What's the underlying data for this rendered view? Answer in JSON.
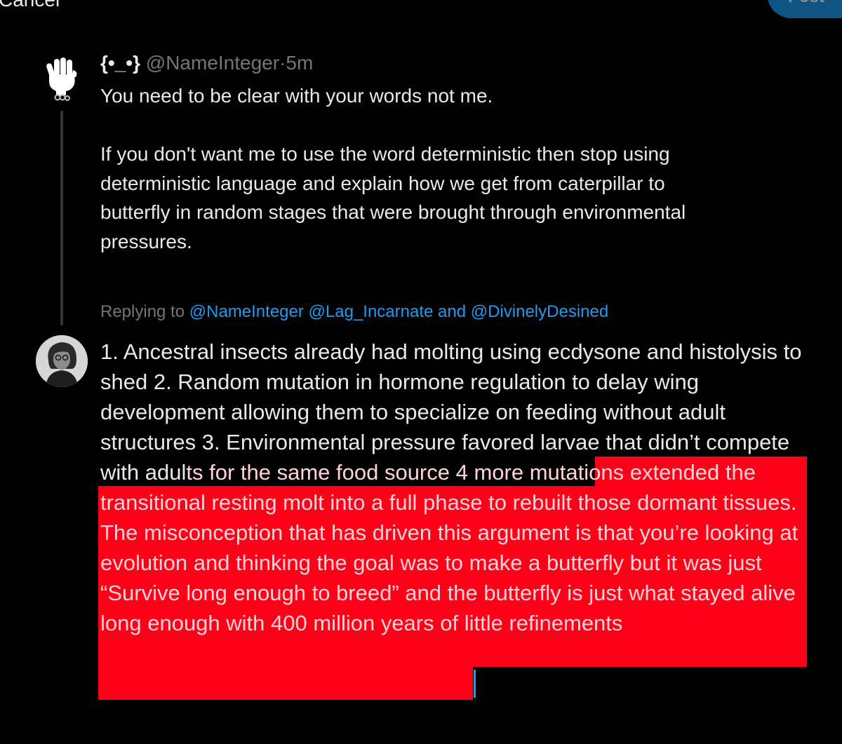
{
  "top_bar": {
    "cancel_label": "Cancel",
    "post_label": "Post"
  },
  "original_tweet": {
    "display_name": "{•_•}",
    "handle": "@NameInteger",
    "separator": "·",
    "time": "5m",
    "paragraphs": [
      "You need to be clear with your words not me.",
      "If you don't want me to use the word deterministic then stop using\ndeterministic language and explain how we get from caterpillar to\nbutterfly in random stages that were brought through environmental\npressures."
    ]
  },
  "reply": {
    "replying_to_label": "Replying to",
    "mentions": [
      "@NameInteger",
      "@Lag_Incarnate",
      "and",
      "@DivinelyDesined"
    ],
    "text_plain": "1. Ancestral insects already had molting using ecdysone and histolysis to shed 2. Random mutation in hormone regulation to delay wing development allowing them to specialize on feeding without adult structures 3. Environmental pressure favored larvae that didn’t compete with adul",
    "text_selected": "ts for the same food source 4 more mutations extended the transitional resting molt into a full phase to rebuilt those dormant tissues. The misconception that has driven this argument is that you’re looking at evolution and thinking the goal was to make a butterfly but it was just “Survive long enough to breed” and the butterfly is just what stayed alive long enough with 400 million years of little refinements"
  },
  "colors": {
    "background": "#000000",
    "text_primary": "#e7e9ea",
    "text_secondary": "#71767b",
    "accent": "#1d9bf0",
    "selection_highlight": "#ff0019"
  },
  "icons": {
    "avatar_original": "raised-fist-avatar",
    "avatar_reply": "profile-photo-avatar"
  }
}
